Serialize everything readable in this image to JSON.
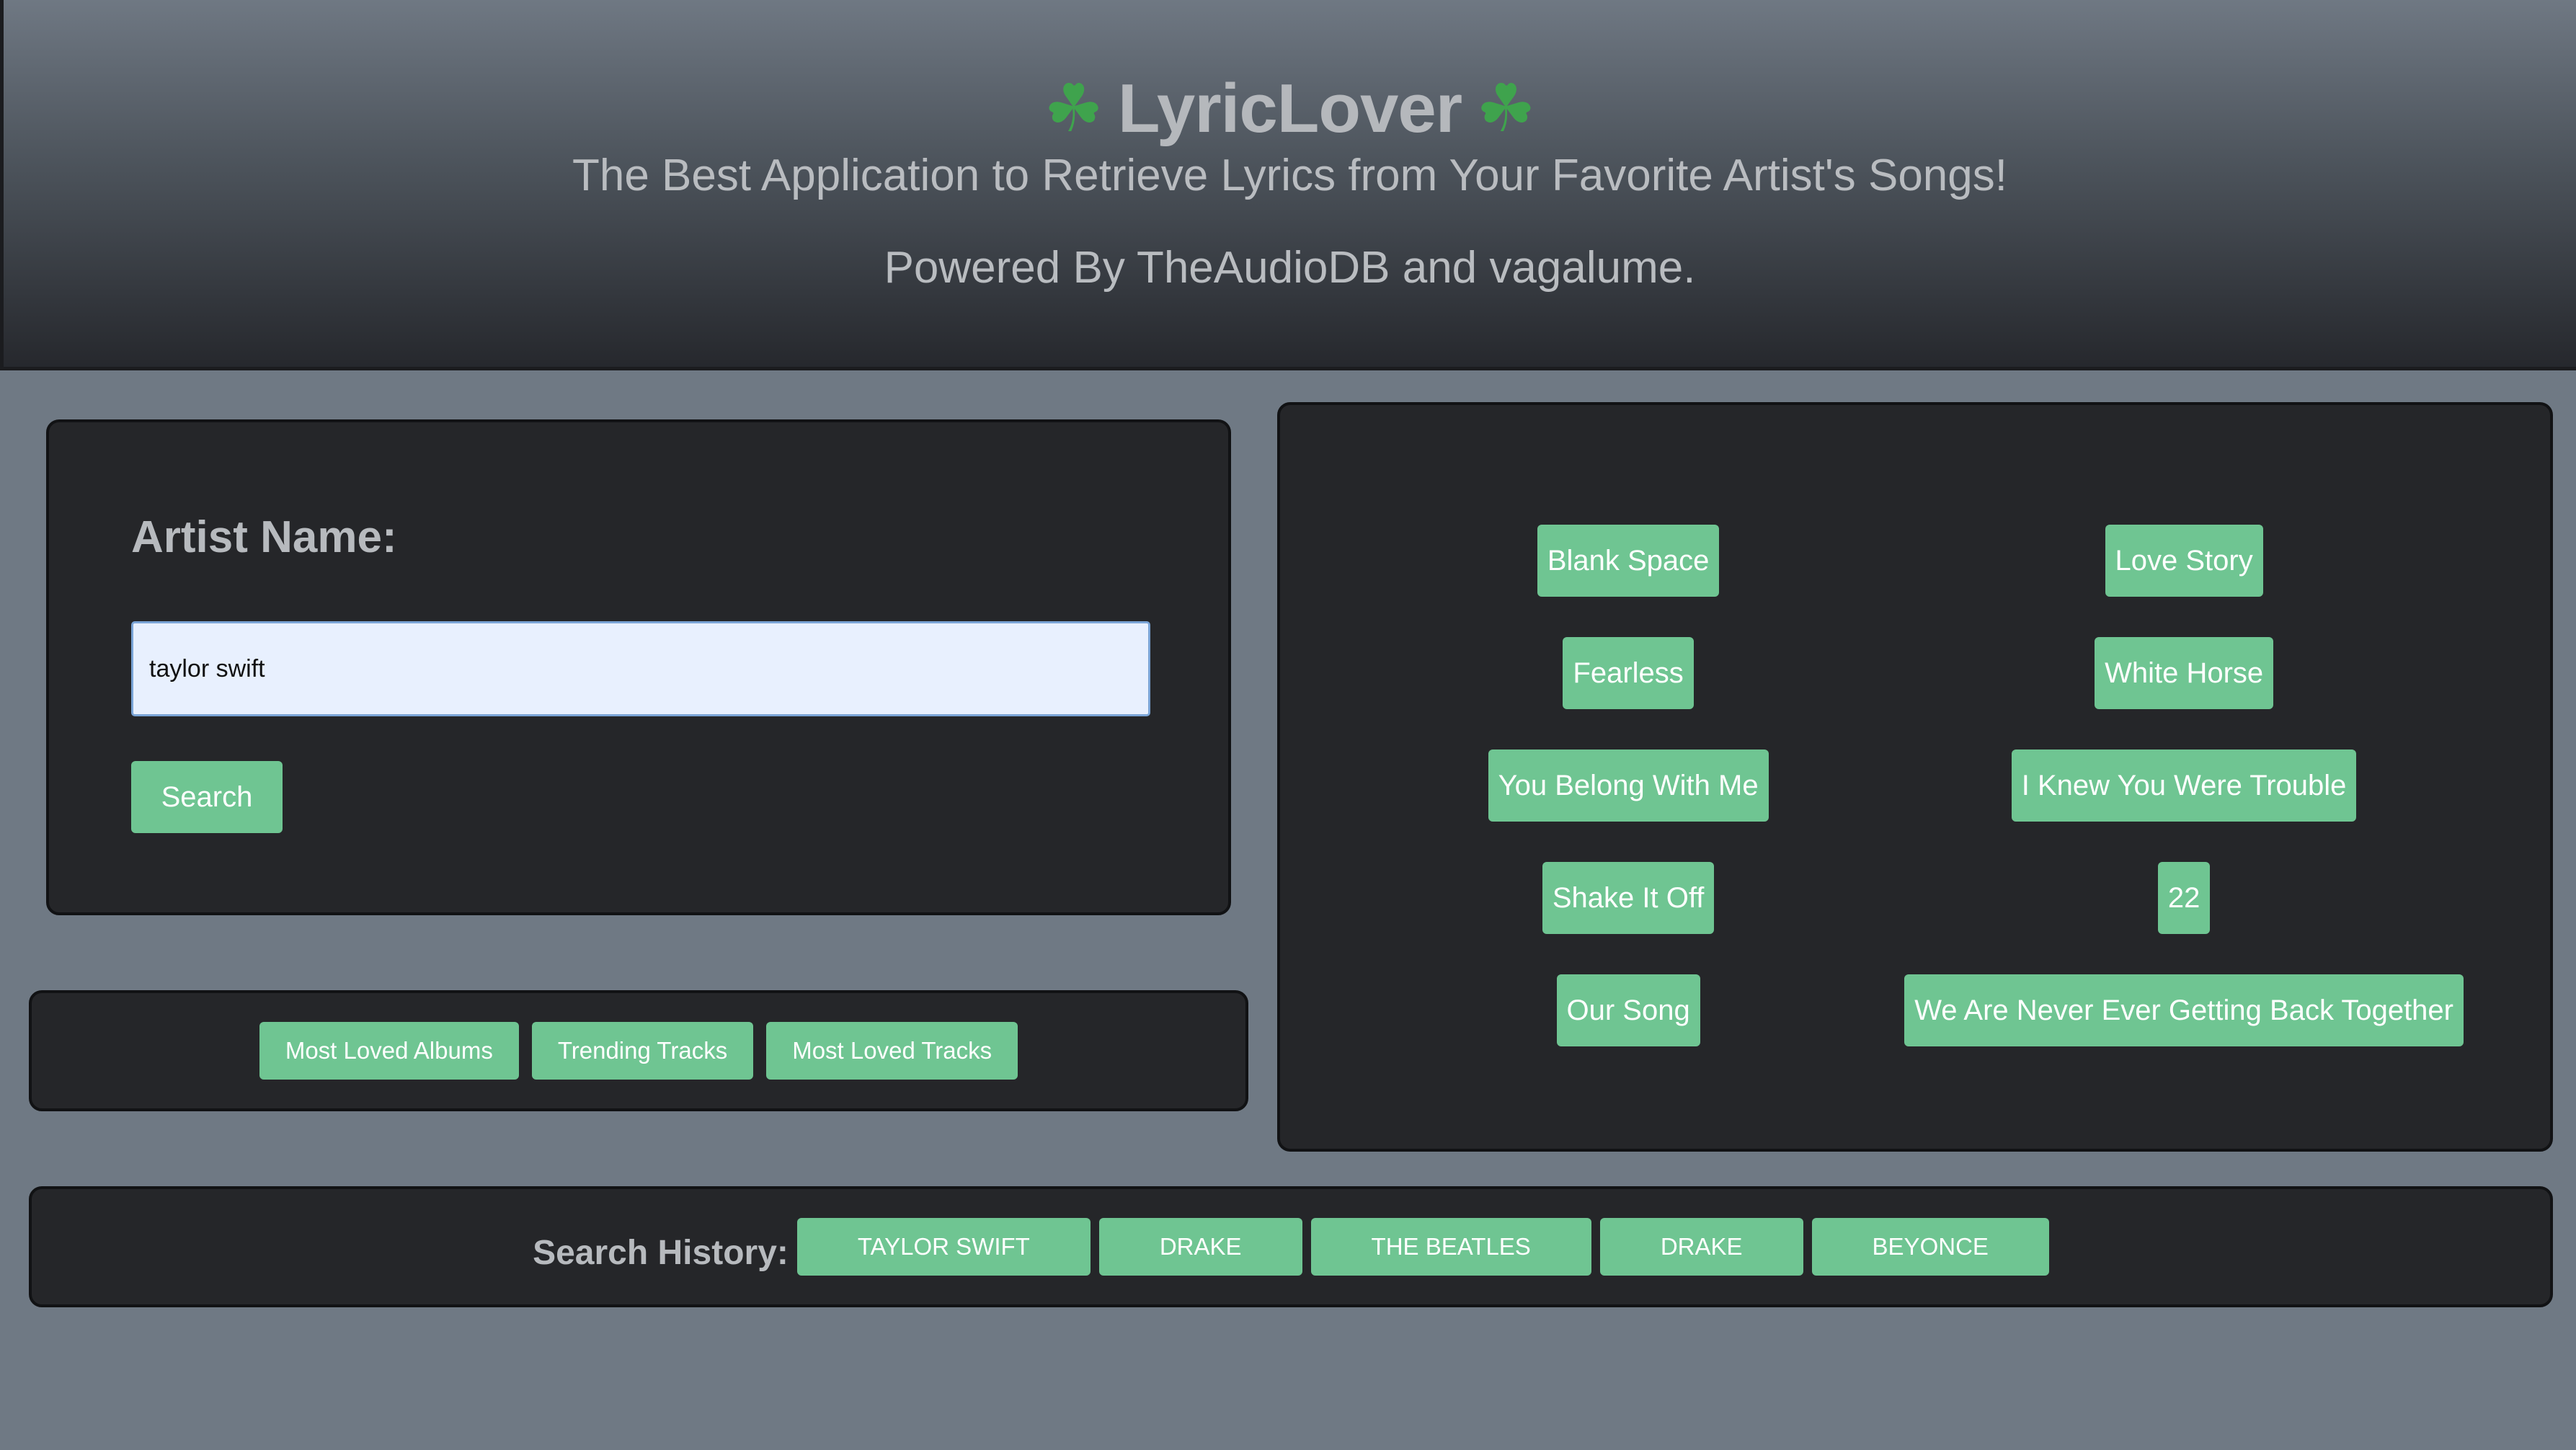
{
  "header": {
    "title": "LyricLover",
    "icon_left": "shamrock-icon",
    "icon_right": "shamrock-icon",
    "tagline": "The Best Application to Retrieve Lyrics from Your Favorite Artist's Songs!",
    "powered_by": "Powered By TheAudioDB and vagalume."
  },
  "search": {
    "label": "Artist Name:",
    "input_value": "taylor swift",
    "button_label": "Search"
  },
  "quick_links": [
    {
      "label": "Most Loved Albums"
    },
    {
      "label": "Trending Tracks"
    },
    {
      "label": "Most Loved Tracks"
    }
  ],
  "songs": [
    {
      "label": "Blank Space"
    },
    {
      "label": "Love Story"
    },
    {
      "label": "Fearless"
    },
    {
      "label": "White Horse"
    },
    {
      "label": "You Belong With Me"
    },
    {
      "label": "I Knew You Were Trouble"
    },
    {
      "label": "Shake It Off"
    },
    {
      "label": "22"
    },
    {
      "label": "Our Song"
    },
    {
      "label": "We Are Never Ever Getting Back Together"
    }
  ],
  "history": {
    "label": "Search History:",
    "items": [
      {
        "label": "TAYLOR SWIFT"
      },
      {
        "label": "DRAKE"
      },
      {
        "label": "THE BEATLES"
      },
      {
        "label": "DRAKE"
      },
      {
        "label": "BEYONCE"
      }
    ]
  },
  "colors": {
    "page_background": "#6f7984",
    "panel_background": "#252629",
    "accent_button": "#6fc592",
    "muted_text": "#b7babe"
  }
}
